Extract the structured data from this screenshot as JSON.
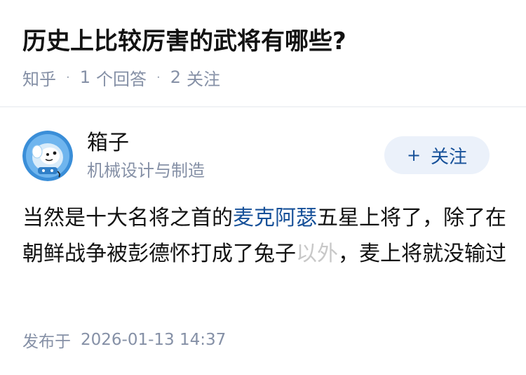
{
  "question": {
    "title": "历史上比较厉害的武将有哪些?",
    "source": "知乎",
    "separator": "·",
    "answer_count": "1",
    "answer_count_label": "个回答",
    "follow_count": "2",
    "follow_count_label": "关注"
  },
  "author": {
    "name": "箱子",
    "headline": "机械设计与制造",
    "avatar_icon": "cartoon-avatar-icon",
    "follow_button": {
      "icon": "+",
      "label": "关注"
    }
  },
  "answer": {
    "text_before_link": "当然是十大名将之首的",
    "link_text": "麦克阿瑟",
    "text_after_link": "五星上将了，除了在朝鲜战争被彭德怀打成了兔子",
    "faded_text": "以外",
    "text_end": "，麦上将就没输过"
  },
  "publish": {
    "label": "发布于",
    "time": "2026-01-13 14:37"
  },
  "colors": {
    "title": "#121212",
    "meta": "#8590a6",
    "link": "#175199",
    "follow_bg": "#ebf1fa",
    "avatar_bg": "#3a8ed8"
  }
}
